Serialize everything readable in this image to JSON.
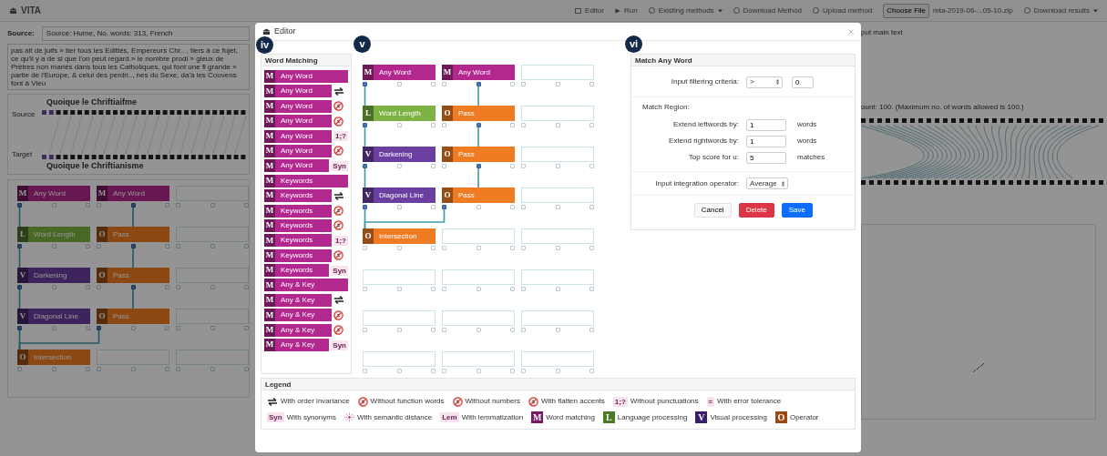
{
  "app": {
    "logo": "VITA",
    "menu": [
      {
        "kind": "editor",
        "label": "Editor"
      },
      {
        "kind": "run",
        "label": "Run"
      },
      {
        "kind": "dropdown",
        "label": "Existing methods"
      },
      {
        "kind": "link",
        "label": "Download Method"
      },
      {
        "kind": "link",
        "label": "Upload method"
      },
      {
        "kind": "file",
        "label": "Choose File",
        "file_name": "mta-2019-06-...05-10.zip"
      },
      {
        "kind": "dropdown",
        "label": "Download results"
      }
    ]
  },
  "background": {
    "source_label": "Source:",
    "source_value": "Source: Hume, No. words: 313, French",
    "hint": "put main text",
    "passage": "pas ait de juifs » tier tous les Edittés, Empereurs Chr.. , tiers à ce fujet, ce qu'il y a de si que l'on peut regard.» le nombre prodi » gieux de Prêtres non mariés dans tous les Catholiques, qui font une fi grande » partie de l'Europe, & celui des perdri.., nes du Sexe, da'à les Couvens font à Vieu",
    "count_note": "ount: 100. (Maximum no. of words allowed is 100.)",
    "alignment": {
      "source_label": "Source",
      "source_text": "Quoique le Chriftiaifme",
      "target_label": "Target",
      "target_text": "Quoique le Chriftianisme"
    },
    "pipeline": {
      "rows": [
        {
          "slots": [
            {
              "kind": "match",
              "letter": "M",
              "label": "Any Word",
              "link": {
                "kind": "left-below"
              }
            },
            {
              "kind": "match",
              "letter": "M",
              "label": "Any Word",
              "link": {
                "kind": "middle-below"
              }
            },
            {
              "kind": "empty"
            }
          ]
        },
        {
          "slots": [
            {
              "kind": "language",
              "letter": "L",
              "label": "Word Length",
              "link": {
                "kind": "left-below"
              }
            },
            {
              "kind": "operator",
              "letter": "O",
              "label": "Pass",
              "link": {
                "kind": "middle-below"
              }
            },
            {
              "kind": "empty"
            }
          ]
        },
        {
          "slots": [
            {
              "kind": "visual",
              "letter": "V",
              "label": "Darkening",
              "link": {
                "kind": "left-below"
              }
            },
            {
              "kind": "operator",
              "letter": "O",
              "label": "Pass",
              "link": {
                "kind": "middle-below"
              }
            },
            {
              "kind": "empty"
            }
          ]
        },
        {
          "slots": [
            {
              "kind": "visual",
              "letter": "V",
              "label": "Diagonal Line",
              "link": {
                "kind": "left-below"
              }
            },
            {
              "kind": "operator",
              "letter": "O",
              "label": "Pass",
              "link": {
                "kind": "left-below-left"
              }
            },
            {
              "kind": "empty"
            }
          ]
        },
        {
          "slots": [
            {
              "kind": "operator",
              "letter": "O",
              "label": "Intersection"
            },
            {
              "kind": "empty"
            },
            {
              "kind": "empty"
            }
          ]
        }
      ]
    }
  },
  "editor": {
    "title": "Editor",
    "markers": [
      {
        "label": "iv",
        "kind": "palette"
      },
      {
        "label": "v",
        "kind": "canvas"
      },
      {
        "label": "vi",
        "kind": "settings"
      }
    ],
    "palette": {
      "title": "Word Matching",
      "items": [
        {
          "color": "#b3288f",
          "letter": "M",
          "label": "Any Word"
        },
        {
          "color": "#b3288f",
          "letter": "M",
          "label": "Any Word",
          "modifier": {
            "kind": "order"
          }
        },
        {
          "color": "#b3288f",
          "letter": "M",
          "label": "Any Word",
          "modifier": {
            "kind": "prohibit"
          }
        },
        {
          "color": "#b3288f",
          "letter": "M",
          "label": "Any Word",
          "modifier": {
            "kind": "prohibit"
          }
        },
        {
          "color": "#b3288f",
          "letter": "M",
          "label": "Any Word",
          "modifier": {
            "kind": "tag",
            "text": "1;?"
          }
        },
        {
          "color": "#b3288f",
          "letter": "M",
          "label": "Any Word",
          "modifier": {
            "kind": "prohibit"
          }
        },
        {
          "color": "#b3288f",
          "letter": "M",
          "label": "Any Word",
          "modifier": {
            "kind": "tag",
            "text": "Syn"
          }
        },
        {
          "color": "#b3288f",
          "letter": "M",
          "label": "Keywords"
        },
        {
          "color": "#b3288f",
          "letter": "M",
          "label": "Keywords",
          "modifier": {
            "kind": "order"
          }
        },
        {
          "color": "#b3288f",
          "letter": "M",
          "label": "Keywords",
          "modifier": {
            "kind": "prohibit"
          }
        },
        {
          "color": "#b3288f",
          "letter": "M",
          "label": "Keywords",
          "modifier": {
            "kind": "prohibit"
          }
        },
        {
          "color": "#b3288f",
          "letter": "M",
          "label": "Keywords",
          "modifier": {
            "kind": "tag",
            "text": "1;?"
          }
        },
        {
          "color": "#b3288f",
          "letter": "M",
          "label": "Keywords",
          "modifier": {
            "kind": "prohibit"
          }
        },
        {
          "color": "#b3288f",
          "letter": "M",
          "label": "Keywords",
          "modifier": {
            "kind": "tag",
            "text": "Syn"
          }
        },
        {
          "color": "#b3288f",
          "letter": "M",
          "label": "Any & Key"
        },
        {
          "color": "#b3288f",
          "letter": "M",
          "label": "Any & Key",
          "modifier": {
            "kind": "order"
          }
        },
        {
          "color": "#b3288f",
          "letter": "M",
          "label": "Any & Key",
          "modifier": {
            "kind": "prohibit"
          }
        },
        {
          "color": "#b3288f",
          "letter": "M",
          "label": "Any & Key",
          "modifier": {
            "kind": "prohibit"
          }
        },
        {
          "color": "#b3288f",
          "letter": "M",
          "label": "Any & Key",
          "modifier": {
            "kind": "tag",
            "text": "Syn"
          }
        }
      ]
    },
    "canvas": {
      "rows": [
        {
          "slots": [
            {
              "kind": "block",
              "color": "#b3288f",
              "letter": "M",
              "label": "Any Word",
              "link": {
                "kind": "left-below"
              }
            },
            {
              "kind": "block",
              "color": "#b3288f",
              "letter": "M",
              "label": "Any Word",
              "link": {
                "kind": "middle-below"
              }
            },
            {
              "kind": "empty"
            }
          ]
        },
        {
          "slots": [
            {
              "kind": "block",
              "color": "#7cb342",
              "letter": "L",
              "label": "Word Length",
              "link": {
                "kind": "left-below"
              }
            },
            {
              "kind": "block",
              "color": "#ef7c22",
              "letter": "O",
              "label": "Pass",
              "link": {
                "kind": "middle-below"
              }
            },
            {
              "kind": "empty"
            }
          ]
        },
        {
          "slots": [
            {
              "kind": "block",
              "color": "#6b3fa0",
              "letter": "V",
              "label": "Darkening",
              "link": {
                "kind": "left-below"
              }
            },
            {
              "kind": "block",
              "color": "#ef7c22",
              "letter": "O",
              "label": "Pass",
              "link": {
                "kind": "middle-below"
              }
            },
            {
              "kind": "empty"
            }
          ]
        },
        {
          "slots": [
            {
              "kind": "block",
              "color": "#6b3fa0",
              "letter": "V",
              "label": "Diagonal Line",
              "link": {
                "kind": "left-below"
              }
            },
            {
              "kind": "block",
              "color": "#ef7c22",
              "letter": "O",
              "label": "Pass",
              "link": {
                "kind": "left-below-left"
              }
            },
            {
              "kind": "empty"
            }
          ]
        },
        {
          "slots": [
            {
              "kind": "block",
              "color": "#ef7c22",
              "letter": "O",
              "label": "Intersection"
            },
            {
              "kind": "empty"
            },
            {
              "kind": "empty"
            }
          ]
        },
        {
          "slots": [
            {
              "kind": "empty"
            },
            {
              "kind": "empty"
            },
            {
              "kind": "empty"
            }
          ]
        },
        {
          "slots": [
            {
              "kind": "empty"
            },
            {
              "kind": "empty"
            },
            {
              "kind": "empty"
            }
          ]
        },
        {
          "slots": [
            {
              "kind": "empty"
            },
            {
              "kind": "empty"
            },
            {
              "kind": "empty"
            }
          ]
        }
      ]
    },
    "settings": {
      "title": "Match Any Word",
      "fields": [
        {
          "kind": "filter",
          "label": "Input filtering criteria:",
          "operator": ">",
          "value": "0"
        },
        {
          "kind": "section",
          "label": "Match Region:"
        },
        {
          "kind": "number",
          "label": "Extend leftwords by:",
          "value": "1",
          "unit": "words"
        },
        {
          "kind": "number",
          "label": "Extend rightwords by:",
          "value": "1",
          "unit": "words"
        },
        {
          "kind": "number",
          "label": "Top score for u:",
          "value": "5",
          "unit": "matches"
        },
        {
          "kind": "select",
          "label": "Input integration operator:",
          "value": "Average"
        }
      ],
      "buttons": [
        {
          "kind": "cancel",
          "label": "Cancel"
        },
        {
          "kind": "delete",
          "label": "Delete"
        },
        {
          "kind": "save",
          "label": "Save"
        }
      ]
    },
    "legend": {
      "title": "Legend",
      "items": [
        {
          "kind": "order",
          "label": "With order invariance"
        },
        {
          "kind": "prohibit",
          "label": "Without function words"
        },
        {
          "kind": "prohibit",
          "label": "Without numbers"
        },
        {
          "kind": "prohibit",
          "label": "With flatten accents"
        },
        {
          "kind": "tag",
          "text": "1;?",
          "label": "Without punctuations"
        },
        {
          "kind": "tag",
          "text": "≈",
          "label": "With error tolerance"
        },
        {
          "kind": "tag",
          "text": "Syn",
          "label": "With synonyms"
        },
        {
          "kind": "semantic",
          "label": "With semantic distance"
        },
        {
          "kind": "tag",
          "text": "Lem",
          "label": "With lemmatization"
        },
        {
          "kind": "letter",
          "color": "#7d1766",
          "text": "M",
          "label": "Word matching"
        },
        {
          "kind": "letter",
          "color": "#4d7a26",
          "text": "L",
          "label": "Language processing"
        },
        {
          "kind": "letter",
          "color": "#3b1e6b",
          "text": "V",
          "label": "Visual processing"
        },
        {
          "kind": "letter",
          "color": "#9c4a12",
          "text": "O",
          "label": "Operator"
        }
      ]
    }
  }
}
